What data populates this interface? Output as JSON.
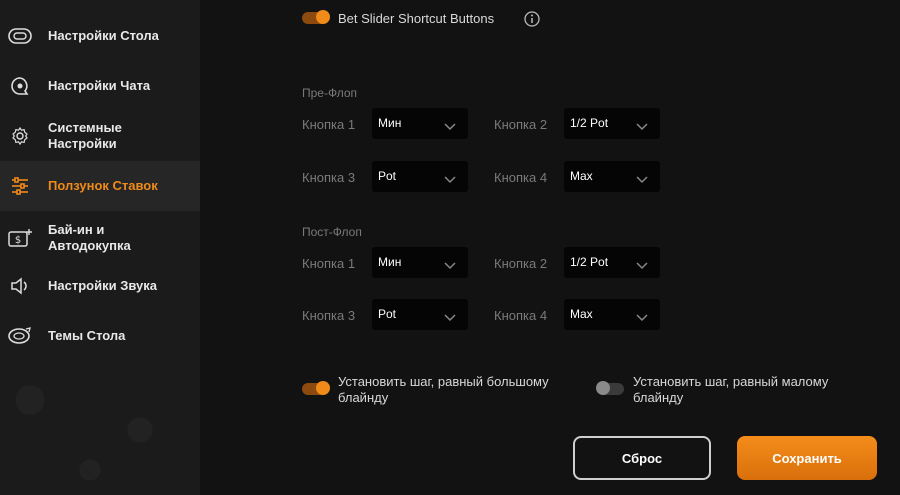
{
  "sidebar": {
    "items": [
      {
        "label": "Настройки Стола",
        "icon": "table-icon"
      },
      {
        "label": "Настройки Чата",
        "icon": "chat-icon"
      },
      {
        "label": "Системные Настройки",
        "icon": "gear-icon"
      },
      {
        "label": "Ползунок Ставок",
        "icon": "slider-icon",
        "active": true
      },
      {
        "label": "Бай-ин и Автодокупка",
        "icon": "buyin-icon"
      },
      {
        "label": "Настройки Звука",
        "icon": "speaker-icon"
      },
      {
        "label": "Темы Стола",
        "icon": "table-theme-icon"
      }
    ]
  },
  "main": {
    "shortcut_toggle": {
      "label": "Bet Slider Shortcut Buttons",
      "on": true
    },
    "preflop": {
      "title": "Пре-Флоп",
      "buttons": [
        {
          "label": "Кнопка 1",
          "value": "Мин"
        },
        {
          "label": "Кнопка 2",
          "value": "1/2 Pot"
        },
        {
          "label": "Кнопка 3",
          "value": "Pot"
        },
        {
          "label": "Кнопка 4",
          "value": "Max"
        }
      ]
    },
    "postflop": {
      "title": "Пост-Флоп",
      "buttons": [
        {
          "label": "Кнопка 1",
          "value": "Мин"
        },
        {
          "label": "Кнопка 2",
          "value": "1/2 Pot"
        },
        {
          "label": "Кнопка 3",
          "value": "Pot"
        },
        {
          "label": "Кнопка 4",
          "value": "Max"
        }
      ]
    },
    "step_big_blind": {
      "label_line1": "Установить шаг, равный большому",
      "label_line2": "блайнду",
      "on": true
    },
    "step_small_blind": {
      "label_line1": "Установить шаг, равный малому",
      "label_line2": "блайнду",
      "on": false
    },
    "reset_label": "Сброс",
    "save_label": "Сохранить"
  },
  "colors": {
    "accent": "#f08a19",
    "background": "#121212",
    "sidebar": "#1b1b1b"
  }
}
